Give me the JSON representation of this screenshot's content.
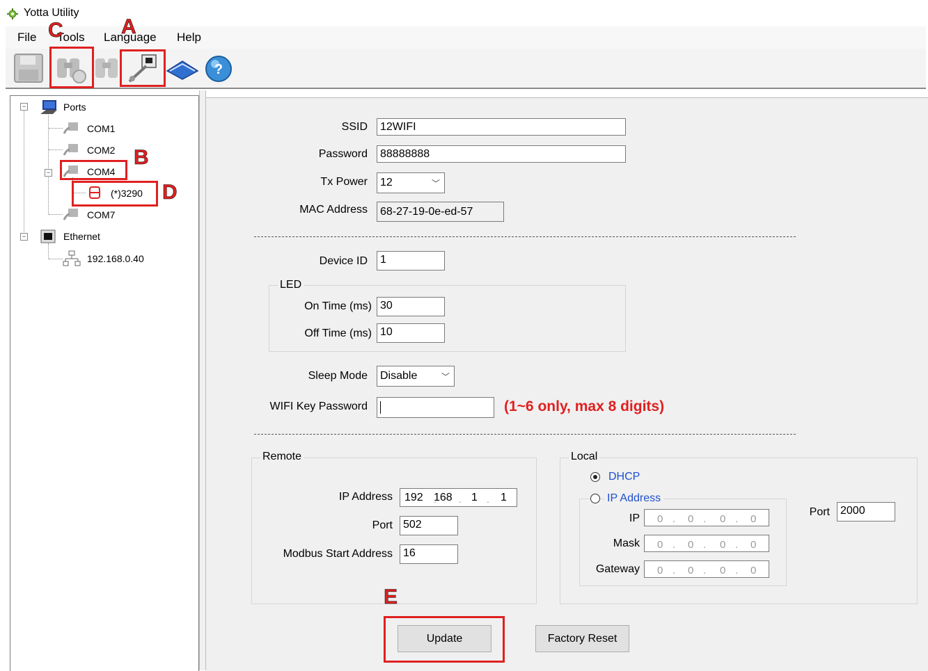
{
  "window": {
    "title": "Yotta Utility"
  },
  "menu": [
    "File",
    "Tools",
    "Language",
    "Help"
  ],
  "toolbar": {
    "icons": [
      "save-icon",
      "search-icon",
      "search-disabled-icon",
      "connect-icon",
      "manual-icon",
      "help-icon"
    ]
  },
  "tree": {
    "ports_label": "Ports",
    "com_ports": [
      "COM1",
      "COM2",
      "COM4",
      "COM7"
    ],
    "device": "(*)3290",
    "ethernet_label": "Ethernet",
    "ethernet_device": "192.168.0.40"
  },
  "wifi": {
    "ssid_label": "SSID",
    "ssid": "12WIFI",
    "password_label": "Password",
    "password": "88888888",
    "txpower_label": "Tx Power",
    "txpower": "12",
    "mac_label": "MAC Address",
    "mac": "68-27-19-0e-ed-57"
  },
  "device": {
    "id_label": "Device ID",
    "id": "1",
    "led_title": "LED",
    "on_label": "On Time (ms)",
    "on": "30",
    "off_label": "Off Time (ms)",
    "off": "10",
    "sleep_label": "Sleep Mode",
    "sleep": "Disable",
    "wifikey_label": "WIFI Key Password",
    "wifikey": "",
    "wifikey_hint": "(1~6 only, max 8 digits)"
  },
  "remote": {
    "title": "Remote",
    "ip_label": "IP Address",
    "ip": [
      "192",
      "168",
      "1",
      "1"
    ],
    "port_label": "Port",
    "port": "502",
    "modbus_label": "Modbus Start Address",
    "modbus": "16"
  },
  "local": {
    "title": "Local",
    "dhcp_label": "DHCP",
    "ipaddr_label": "IP Address",
    "ip_label": "IP",
    "ip": [
      "0",
      "0",
      "0",
      "0"
    ],
    "mask_label": "Mask",
    "mask": [
      "0",
      "0",
      "0",
      "0"
    ],
    "gateway_label": "Gateway",
    "gateway": [
      "0",
      "0",
      "0",
      "0"
    ],
    "port_label": "Port",
    "port": "2000"
  },
  "buttons": {
    "update": "Update",
    "factory_reset": "Factory Reset"
  },
  "markers": {
    "a": "A",
    "b": "B",
    "c": "C",
    "d": "D",
    "e": "E"
  },
  "colors": {
    "marker_red": "#e02020",
    "link_blue": "#1f4fd0"
  }
}
